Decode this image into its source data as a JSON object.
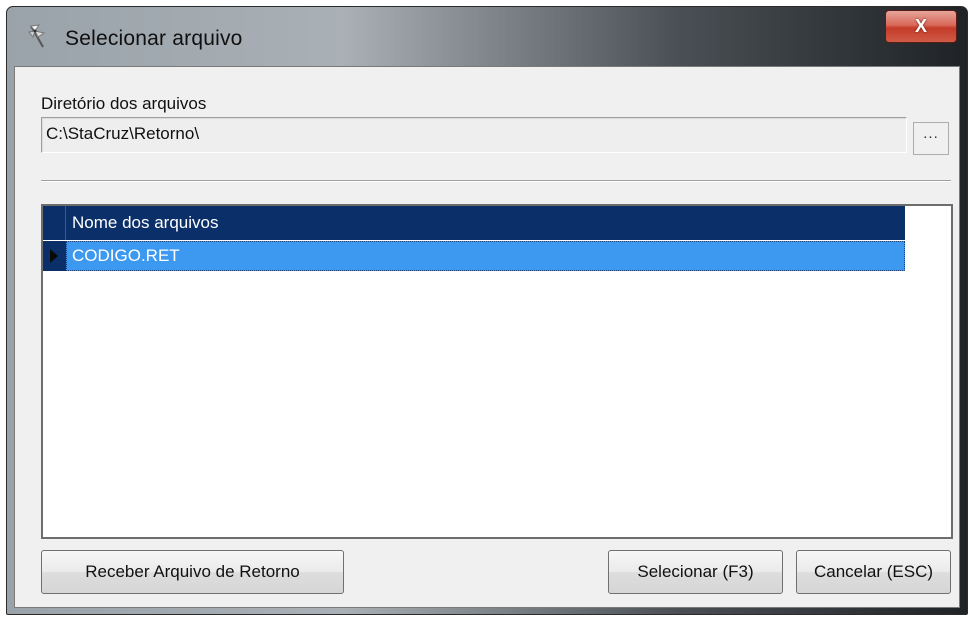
{
  "window": {
    "title": "Selecionar arquivo",
    "close_label": "X"
  },
  "directory": {
    "label": "Diretório dos arquivos",
    "value": "C:\\StaCruz\\Retorno\\",
    "browse_label": "..."
  },
  "grid": {
    "column_header": "Nome dos arquivos",
    "rows": [
      {
        "name": "CODIGO.RET",
        "selected": true
      }
    ]
  },
  "buttons": {
    "receive_label": "Receber Arquivo de Retorno",
    "select_label": "Selecionar (F3)",
    "cancel_label": "Cancelar (ESC)"
  },
  "colors": {
    "grid_header": "#0b2f69",
    "selected_row": "#3d99f0",
    "close_button": "#c43b29"
  },
  "icons": {
    "app": "pinwheel-icon",
    "close": "close-icon",
    "row_indicator": "triangle-right-icon"
  }
}
